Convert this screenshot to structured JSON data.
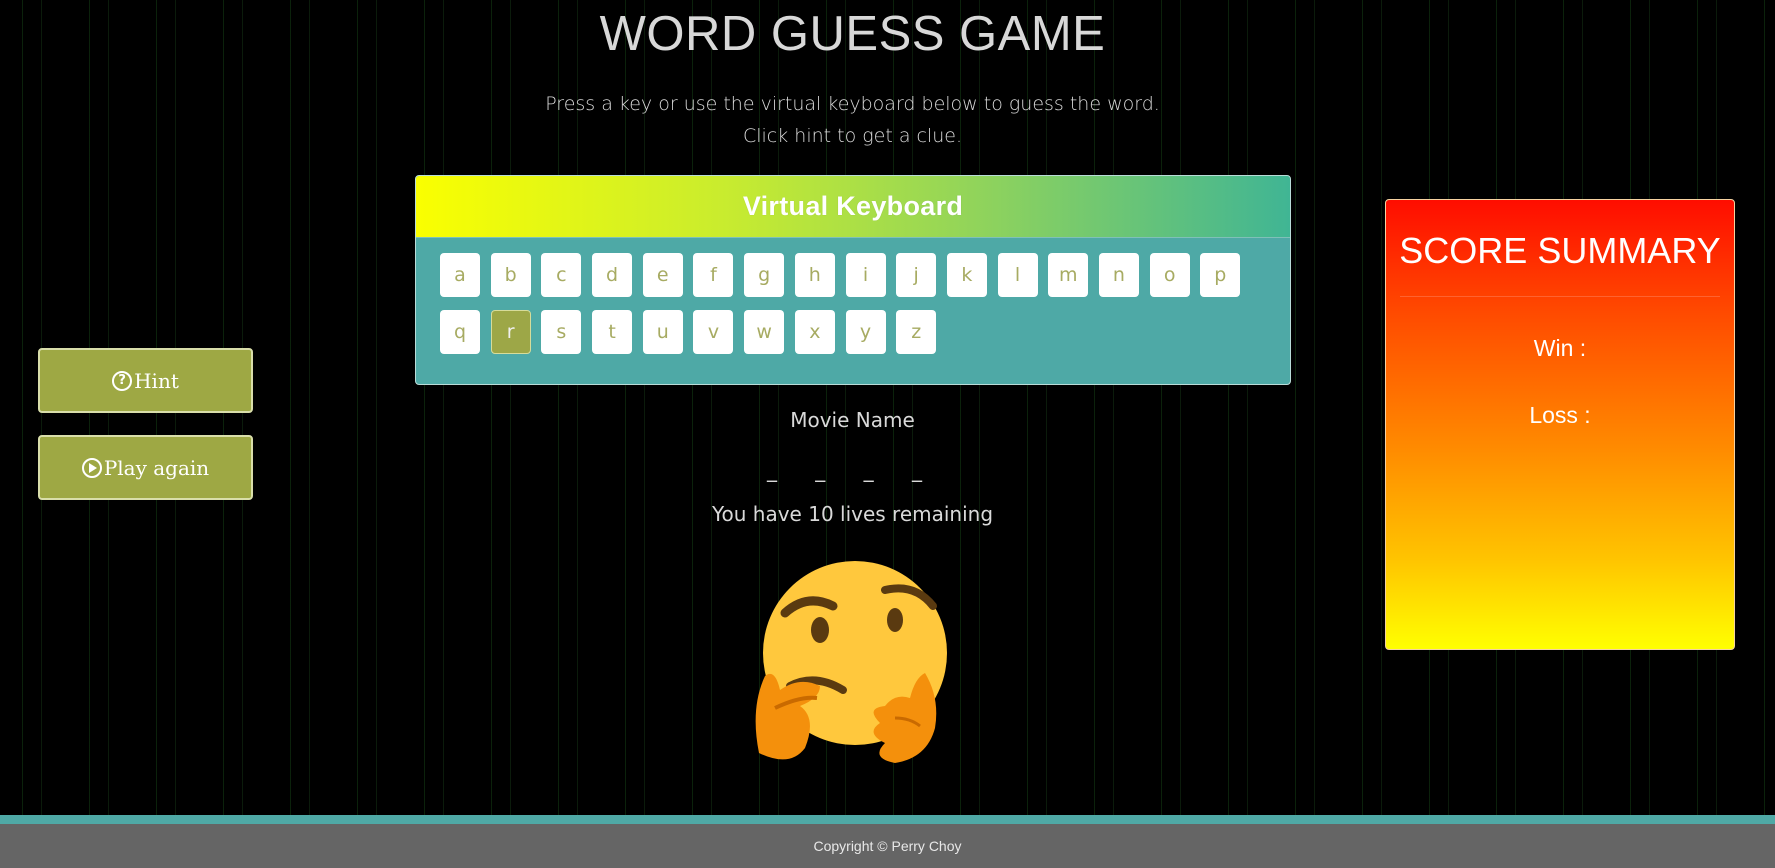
{
  "header": {
    "title": "WORD GUESS GAME",
    "instruction_line1": "Press a key or use the virtual keyboard below to guess the word.",
    "instruction_line2": "Click hint to get a clue."
  },
  "keyboard": {
    "title": "Virtual Keyboard",
    "row1": [
      "a",
      "b",
      "c",
      "d",
      "e",
      "f",
      "g",
      "h",
      "i",
      "j",
      "k",
      "l",
      "m",
      "n",
      "o",
      "p"
    ],
    "row2": [
      "q",
      "r",
      "s",
      "t",
      "u",
      "v",
      "w",
      "x",
      "y",
      "z"
    ],
    "used_keys": [
      "r"
    ]
  },
  "controls": {
    "hint_label": "Hint",
    "hint_icon": "question-circle-icon",
    "play_again_label": "Play again",
    "play_again_icon": "play-circle-icon"
  },
  "game": {
    "category": "Movie Name",
    "blanks": "_ _ _ _",
    "lives_text": "You have 10 lives remaining",
    "image": "thinking-face-emoji"
  },
  "score": {
    "title": "SCORE SUMMARY",
    "win_label": "Win :",
    "loss_label": "Loss :"
  },
  "footer": {
    "copyright": "Copyright © Perry Choy"
  },
  "colors": {
    "accent_olive": "#9ea844",
    "keyboard_panel": "#4ea9a6",
    "score_top": "#ff0d00",
    "score_bottom": "#ffff00",
    "footer_bg": "#656565"
  }
}
